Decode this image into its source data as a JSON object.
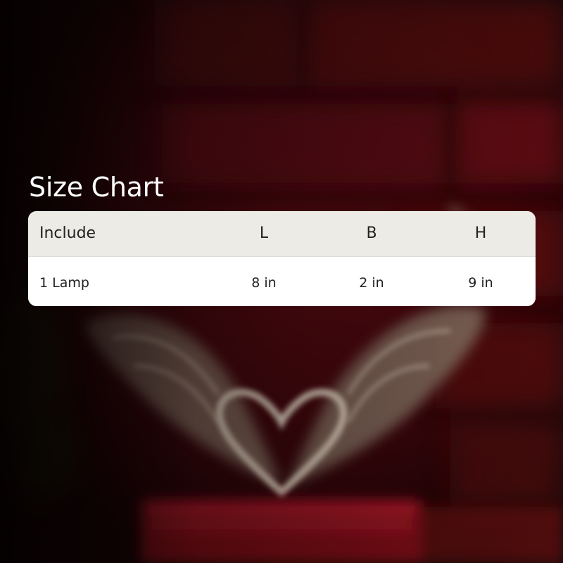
{
  "title": "Size Chart",
  "table": {
    "headers": [
      "Include",
      "L",
      "B",
      "H"
    ],
    "rows": [
      [
        "1 Lamp",
        "8 in",
        "2 in",
        "9 in"
      ]
    ]
  },
  "colors": {
    "header_background": "#ecebe6",
    "row_background": "#ffffff",
    "title_text": "#ffffff",
    "table_text": "#222222"
  },
  "background_image": "blurred photo of a heart-and-wings lamp on a red base against a dark red brick wall"
}
